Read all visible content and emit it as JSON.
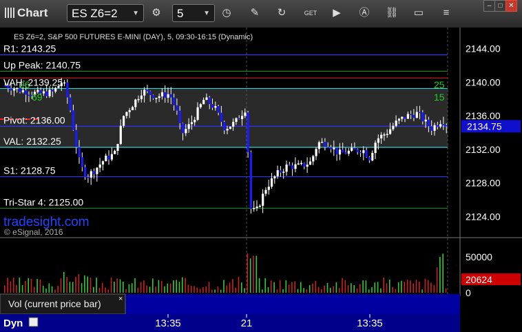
{
  "toolbar": {
    "title": "Chart",
    "symbol": "ES Z6=2",
    "interval": "5",
    "icons": [
      "gear-icon",
      "clock-icon",
      "pencil-icon",
      "refresh-icon",
      "get-icon",
      "play-icon",
      "a-icon",
      "link-icon",
      "chat-icon",
      "list-icon"
    ]
  },
  "chart_data": {
    "type": "candlestick",
    "header": "ES Z6=2, S&P 500 FUTURES E-MINI (DAY), 5, 09:30-16:15 (Dynamic)",
    "watermark": "tradesight.com",
    "copyright": "© eSignal, 2016",
    "last_price": "2134.75",
    "y_ticks": [
      "2144.00",
      "2140.00",
      "2136.00",
      "2132.00",
      "2128.00",
      "2124.00"
    ],
    "ylim": [
      2121.5,
      2146.5
    ],
    "levels": [
      {
        "label": "R1: 2143.25",
        "value": 2143.25,
        "color": "#3333ff"
      },
      {
        "label": "Up Peak: 2140.75",
        "value": 2141.3,
        "color": "#1a8c1a"
      },
      {
        "label": "",
        "value": 2140.5,
        "color": "#cc2020"
      },
      {
        "label": "VAH: 2139.25",
        "value": 2139.25,
        "color": "#40d0d0"
      },
      {
        "label": "Pivot: 2136.00",
        "value": 2134.75,
        "color": "#3333ff"
      },
      {
        "label": "VAL: 2132.25",
        "value": 2132.25,
        "color": "#40d0d0"
      },
      {
        "label": "S1: 2128.75",
        "value": 2128.75,
        "color": "#3333ff"
      },
      {
        "label": "Tri-Star 4: 2125.00",
        "value": 2125.0,
        "color": "#1a8c1a"
      }
    ],
    "markers": [
      "26",
      "69",
      "25",
      "15"
    ],
    "volume": {
      "label": "Vol (current price bar)",
      "last_value": "20624",
      "y_ticks": [
        "50000",
        "0"
      ],
      "ylim": [
        0,
        72000
      ]
    },
    "x_ticks": [
      "13:35",
      "21",
      "13:35"
    ]
  },
  "status": {
    "label": "Dyn"
  }
}
